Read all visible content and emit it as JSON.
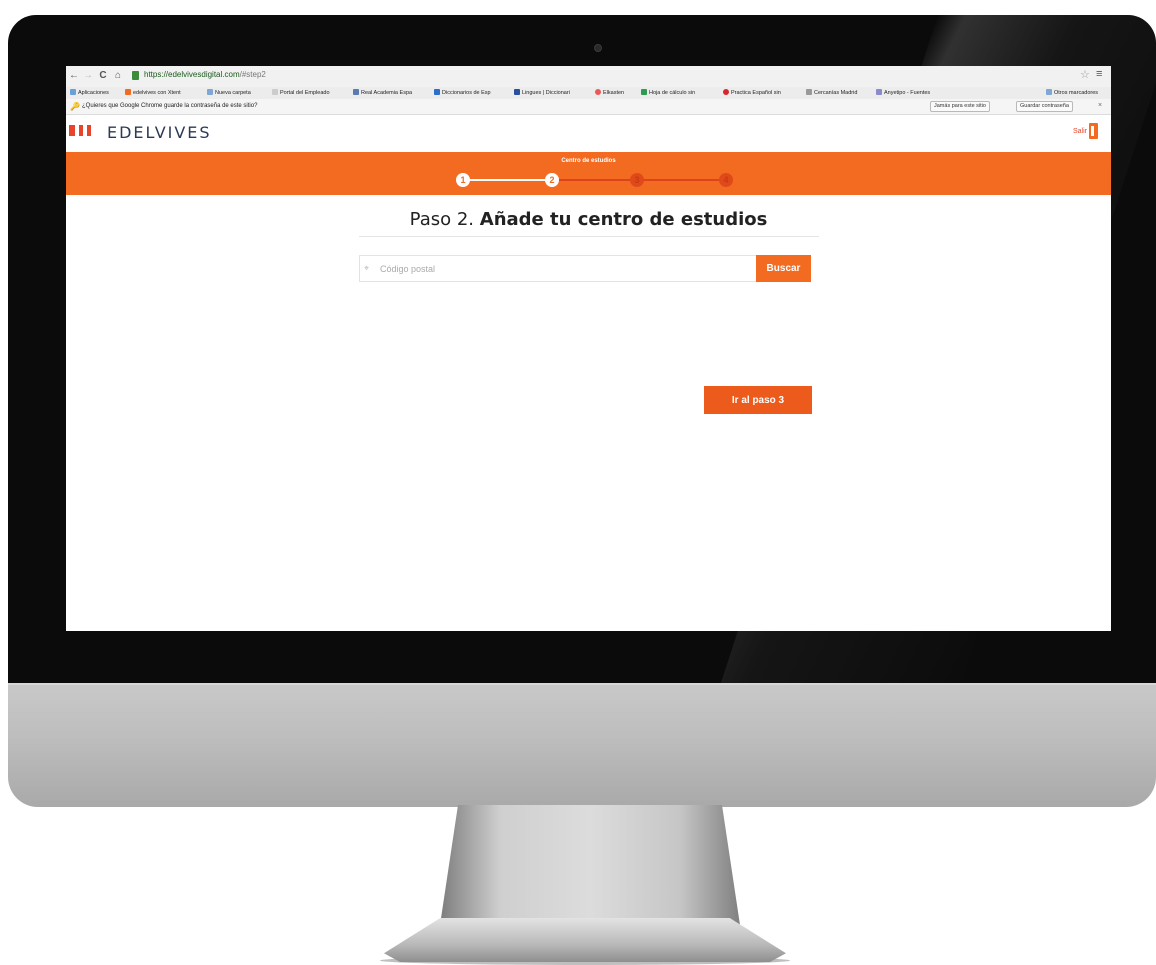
{
  "browser": {
    "url_host": "https://edelvivesdigital.com",
    "url_path": "/#step2",
    "bookmarks": [
      {
        "label": "Aplicaciones",
        "color": "#6aa0d8"
      },
      {
        "label": "edelvives con Xtent",
        "color": "#f26b21"
      },
      {
        "label": "Nueva carpeta",
        "color": "#7fa7d6"
      },
      {
        "label": "Portal del Empleado",
        "color": "#cccccc"
      },
      {
        "label": "Real Academia Espa",
        "color": "#5a7bb0"
      },
      {
        "label": "Diccionarios de Esp",
        "color": "#2a6fcf"
      },
      {
        "label": "Lingues | Diccionari",
        "color": "#2a4f9f"
      },
      {
        "label": "Elkasten",
        "color": "#e85a5a"
      },
      {
        "label": "Hoja de cálculo sin",
        "color": "#2e9a4e"
      },
      {
        "label": "Practica Español sin",
        "color": "#d9242b"
      },
      {
        "label": "Cercanías Madrid",
        "color": "#999999"
      },
      {
        "label": "Anyetipo - Fuentes",
        "color": "#8a8acc"
      },
      {
        "label": "Otros marcadores",
        "color": "#7fa7d6"
      }
    ],
    "password_prompt": "¿Quieres que Google Chrome guarde la contraseña de este sitio?",
    "never_button": "Jamás para este sitio",
    "save_button": "Guardar contraseña"
  },
  "site": {
    "logo": "EDELVIVES",
    "logout": "Salir",
    "brand_color": "#f26b21"
  },
  "progress": {
    "label": "Centro de estudios",
    "steps": [
      "1",
      "2",
      "3",
      "4"
    ],
    "current_step": 2
  },
  "main": {
    "title_prefix": "Paso 2.",
    "title_strong": "Añade tu centro de estudios",
    "search_placeholder": "Código postal",
    "search_button": "Buscar",
    "next_button": "Ir al paso 3"
  }
}
